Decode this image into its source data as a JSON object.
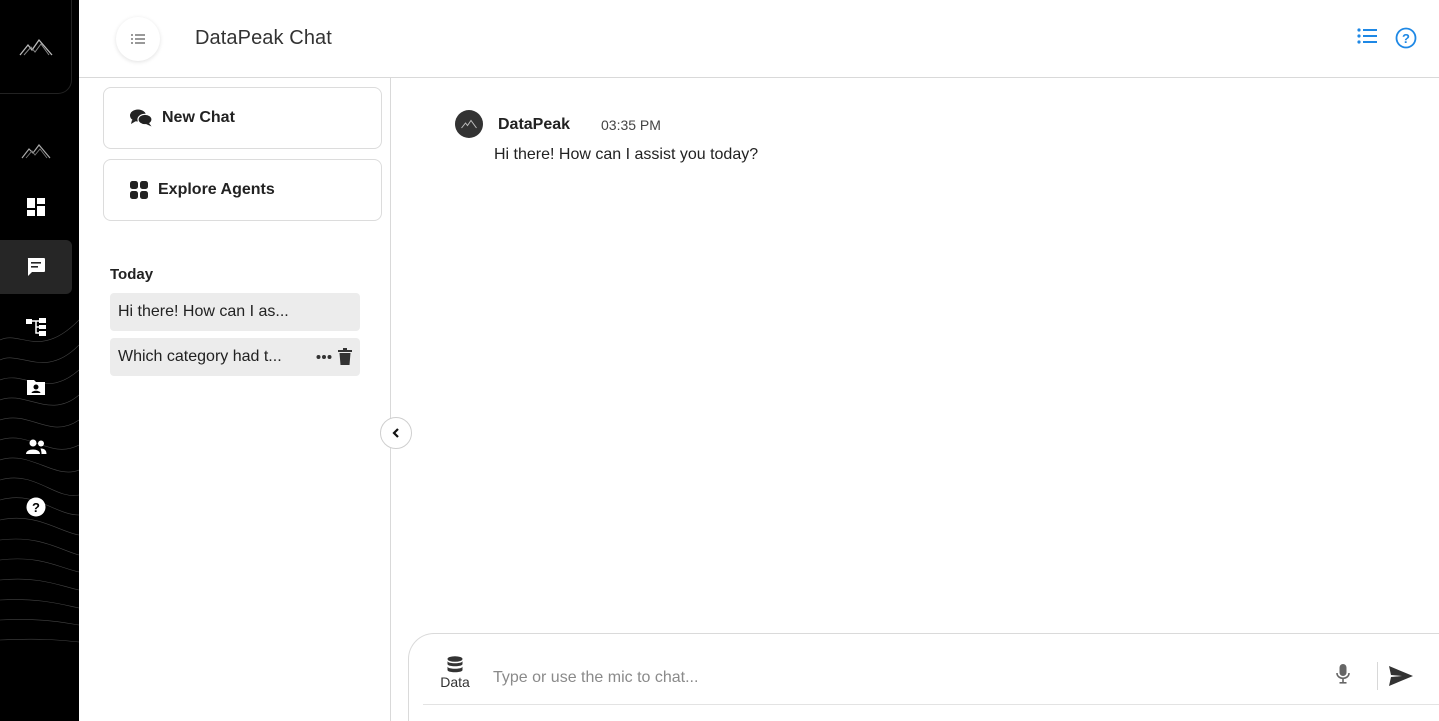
{
  "header": {
    "title": "DataPeak Chat"
  },
  "sidebar": {
    "new_chat_label": "New Chat",
    "explore_agents_label": "Explore Agents",
    "section_today": "Today",
    "history": [
      {
        "label": "Hi there! How can I as..."
      },
      {
        "label": "Which category had t..."
      }
    ]
  },
  "chat": {
    "messages": [
      {
        "sender": "DataPeak",
        "time": "03:35 PM",
        "text": "Hi there! How can I assist you today?"
      }
    ]
  },
  "composer": {
    "data_label": "Data",
    "placeholder": "Type or use the mic to chat..."
  },
  "colors": {
    "accent": "#1e88e5",
    "rail": "#000000",
    "rail_active": "#262626"
  },
  "icons": {
    "rail": [
      "mountain-logo-icon",
      "mountain-icon",
      "dashboard-icon",
      "chat-icon",
      "hierarchy-icon",
      "folder-user-icon",
      "people-icon",
      "help-icon"
    ],
    "header": [
      "menu-icon",
      "list-icon",
      "help-circle-icon"
    ]
  }
}
